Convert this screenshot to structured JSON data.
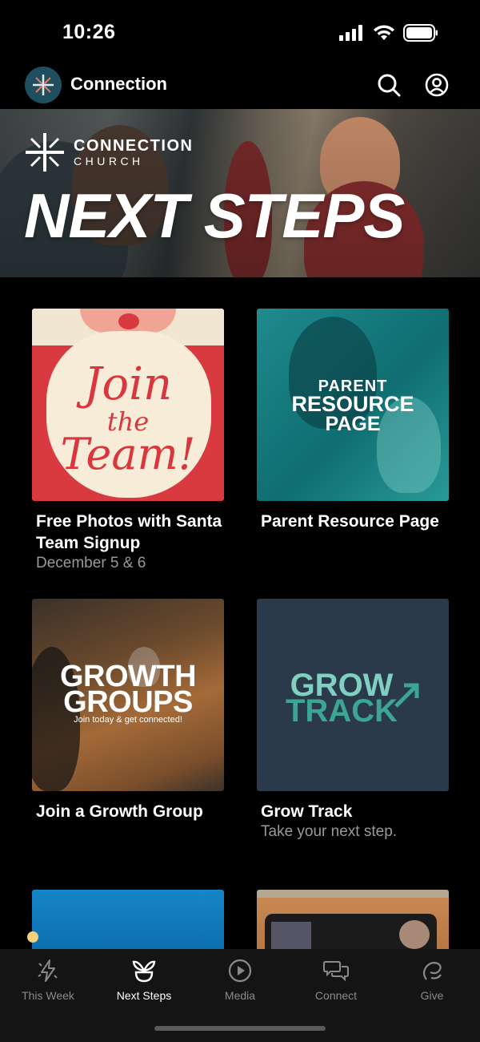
{
  "status": {
    "time": "10:26"
  },
  "header": {
    "title": "Connection"
  },
  "hero": {
    "brand_name": "CONNECTION",
    "brand_sub": "CHURCH",
    "title": "NEXT STEPS"
  },
  "cards": [
    {
      "image_text": [
        "Join",
        "the",
        "Team!"
      ],
      "title": "Free Photos with Santa Team Signup",
      "subtitle": "December 5 & 6"
    },
    {
      "image_text": [
        "PARENT",
        "RESOURCE",
        "PAGE"
      ],
      "title": "Parent Resource Page",
      "subtitle": ""
    },
    {
      "image_text": [
        "GROWTH",
        "GROUPS",
        "Join today & get connected!"
      ],
      "title": "Join a Growth Group",
      "subtitle": ""
    },
    {
      "image_text": [
        "GROW",
        "TRACK"
      ],
      "title": "Grow Track",
      "subtitle": "Take your next step."
    }
  ],
  "tabs": [
    {
      "label": "This Week",
      "icon": "lightning-icon",
      "active": false
    },
    {
      "label": "Next Steps",
      "icon": "sprout-icon",
      "active": true
    },
    {
      "label": "Media",
      "icon": "play-circle-icon",
      "active": false
    },
    {
      "label": "Connect",
      "icon": "chat-bubbles-icon",
      "active": false
    },
    {
      "label": "Give",
      "icon": "give-icon",
      "active": false
    }
  ],
  "colors": {
    "background": "#000000",
    "tab_bar": "#141414",
    "subtitle_gray": "#9a9a9a",
    "teal": "#1f8a8c",
    "grow_track_teal": "#7fd0c0",
    "santa_red": "#d93a40"
  }
}
